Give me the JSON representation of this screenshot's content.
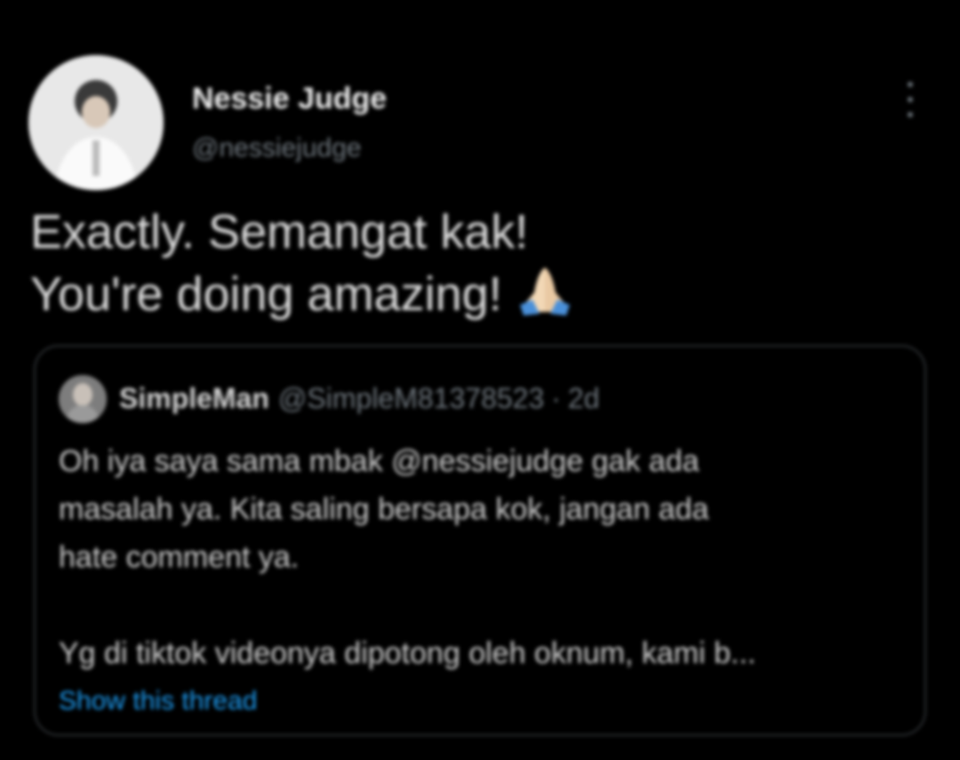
{
  "tweet": {
    "author": {
      "display_name": "Nessie Judge",
      "handle": "@nessiejudge",
      "avatar_icon": "profile-photo"
    },
    "text_lines": [
      "Exactly. Semangat kak!",
      "You're doing amazing!"
    ],
    "emoji": "folded-hands-emoji",
    "more_icon": "more-options-icon",
    "quoted_tweet": {
      "display_name": "SimpleMan",
      "handle": "@SimpleM81378523",
      "separator": "·",
      "time": "2d",
      "avatar_icon": "profile-photo",
      "body_lines": [
        "Oh iya saya sama mbak @nessiejudge gak ada",
        "masalah ya. Kita saling bersapa kok, jangan ada",
        "hate comment ya.",
        "",
        "Yg di tiktok videonya dipotong oleh oknum, kami b..."
      ],
      "show_thread": "Show this thread"
    }
  },
  "colors": {
    "background": "#000000",
    "text_primary": "#dcdcdc",
    "text_secondary": "#6e767d",
    "link": "#1d9bf0",
    "border": "#2f3336"
  }
}
